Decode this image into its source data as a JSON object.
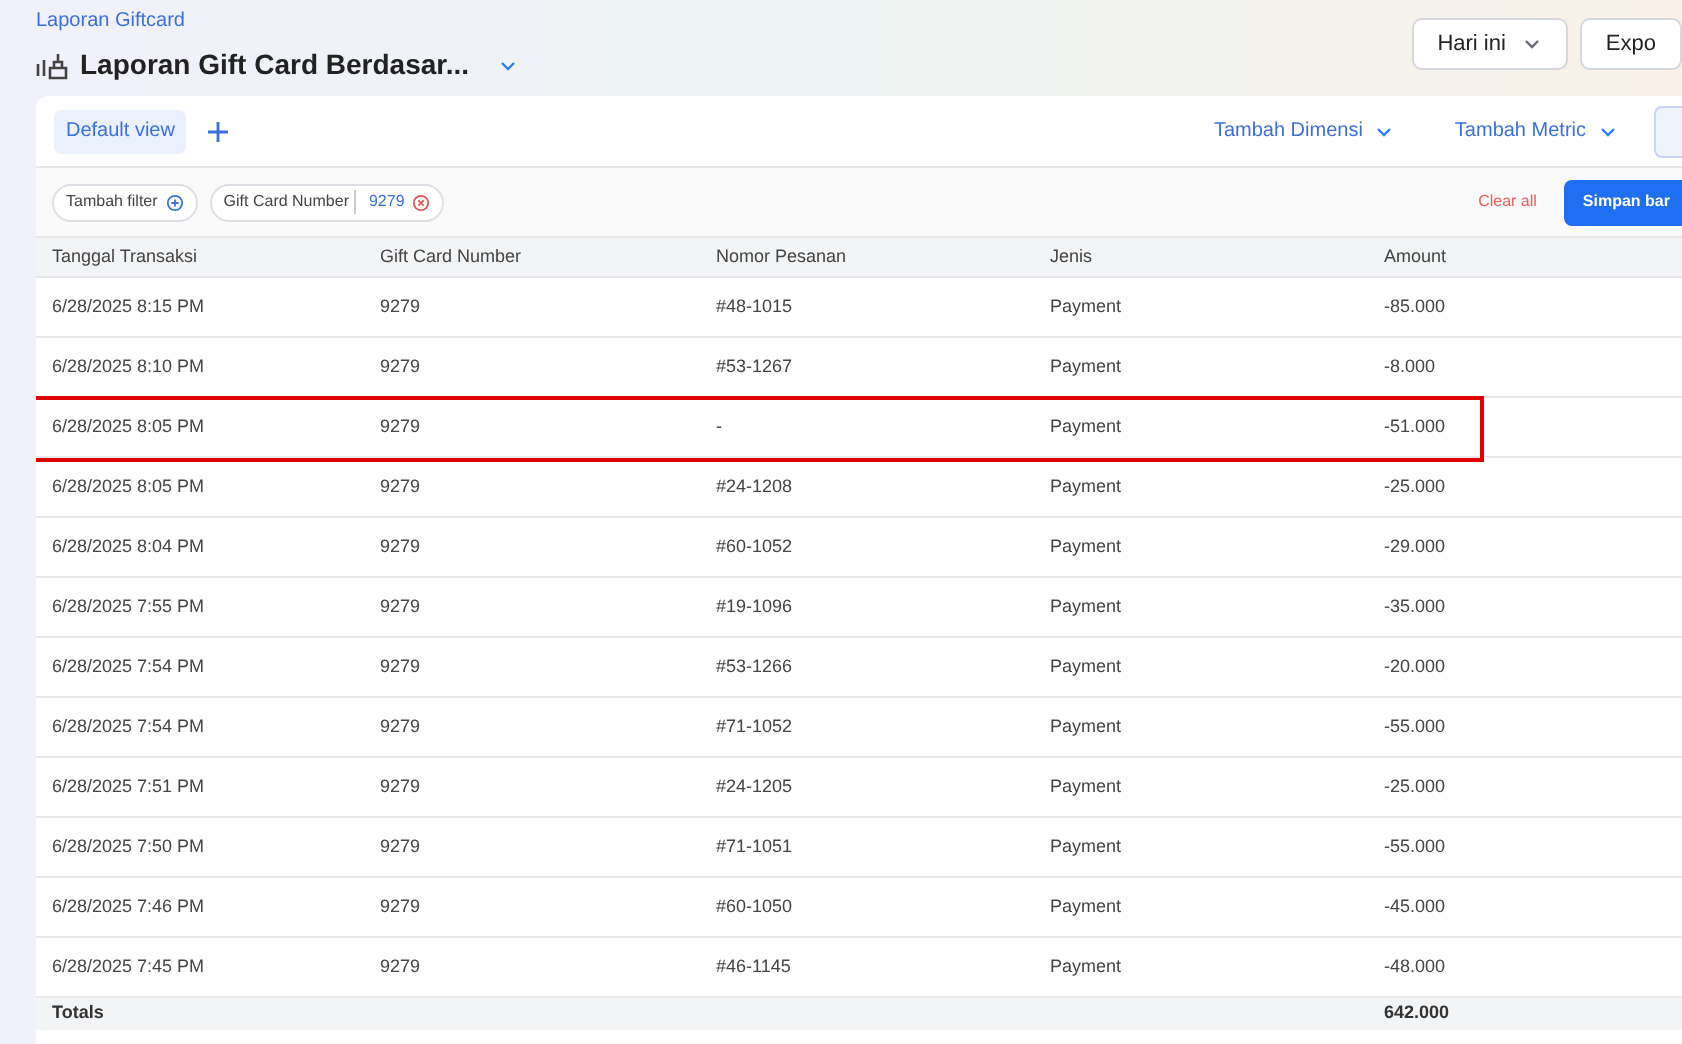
{
  "breadcrumb": "Laporan Giftcard",
  "title": "Laporan Gift Card Berdasar...",
  "header_buttons": [
    {
      "label": "Hari ini",
      "kind": "dropdown"
    },
    {
      "label": "Expo",
      "kind": "plain"
    }
  ],
  "tabs": [
    {
      "label": "Default view",
      "selected": true
    }
  ],
  "toolbar": {
    "dimension": "Tambah Dimensi",
    "metric": "Tambah Metric"
  },
  "filters": {
    "add": "Tambah filter",
    "chip": {
      "field": "Gift Card Number",
      "value": "9279"
    },
    "clear": "Clear all",
    "save": "Simpan bar"
  },
  "table": {
    "columns": [
      "Tanggal Transaksi",
      "Gift Card Number",
      "Nomor Pesanan",
      "Jenis",
      "Amount"
    ],
    "rows": [
      {
        "cells": [
          "6/28/2025 8:15 PM",
          "9279",
          "#48-1015",
          "Payment",
          "-85.000"
        ],
        "highlighted": false
      },
      {
        "cells": [
          "6/28/2025 8:10 PM",
          "9279",
          "#53-1267",
          "Payment",
          "-8.000"
        ],
        "highlighted": false
      },
      {
        "cells": [
          "6/28/2025 8:05 PM",
          "9279",
          "-",
          "Payment",
          "-51.000"
        ],
        "highlighted": true
      },
      {
        "cells": [
          "6/28/2025 8:05 PM",
          "9279",
          "#24-1208",
          "Payment",
          "-25.000"
        ],
        "highlighted": false
      },
      {
        "cells": [
          "6/28/2025 8:04 PM",
          "9279",
          "#60-1052",
          "Payment",
          "-29.000"
        ],
        "highlighted": false
      },
      {
        "cells": [
          "6/28/2025 7:55 PM",
          "9279",
          "#19-1096",
          "Payment",
          "-35.000"
        ],
        "highlighted": false
      },
      {
        "cells": [
          "6/28/2025 7:54 PM",
          "9279",
          "#53-1266",
          "Payment",
          "-20.000"
        ],
        "highlighted": false
      },
      {
        "cells": [
          "6/28/2025 7:54 PM",
          "9279",
          "#71-1052",
          "Payment",
          "-55.000"
        ],
        "highlighted": false
      },
      {
        "cells": [
          "6/28/2025 7:51 PM",
          "9279",
          "#24-1205",
          "Payment",
          "-25.000"
        ],
        "highlighted": false
      },
      {
        "cells": [
          "6/28/2025 7:50 PM",
          "9279",
          "#71-1051",
          "Payment",
          "-55.000"
        ],
        "highlighted": false
      },
      {
        "cells": [
          "6/28/2025 7:46 PM",
          "9279",
          "#60-1050",
          "Payment",
          "-45.000"
        ],
        "highlighted": false
      },
      {
        "cells": [
          "6/28/2025 7:45 PM",
          "9279",
          "#46-1145",
          "Payment",
          "-48.000"
        ],
        "highlighted": false
      }
    ],
    "totals": {
      "label": "Totals",
      "amount": "642.000"
    }
  }
}
